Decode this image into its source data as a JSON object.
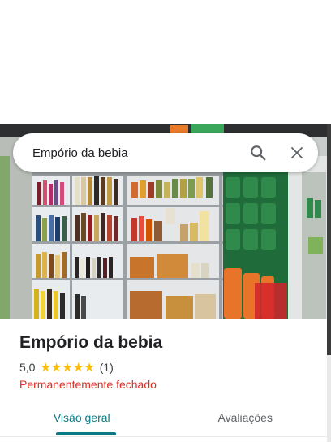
{
  "search": {
    "value": "Empório da bebia"
  },
  "place": {
    "name": "Empório da bebia",
    "rating": "5,0",
    "stars": [
      "★",
      "★",
      "★",
      "★",
      "★"
    ],
    "review_count": "(1)",
    "status": "Permanentemente fechado"
  },
  "tabs": [
    {
      "label": "Visão geral",
      "active": true
    },
    {
      "label": "Avaliações",
      "active": false
    }
  ],
  "colors": {
    "accent": "#0b7a82",
    "closed": "#d93025",
    "star": "#fbbc04"
  },
  "icons": {
    "search": "search-icon",
    "close": "close-icon"
  }
}
